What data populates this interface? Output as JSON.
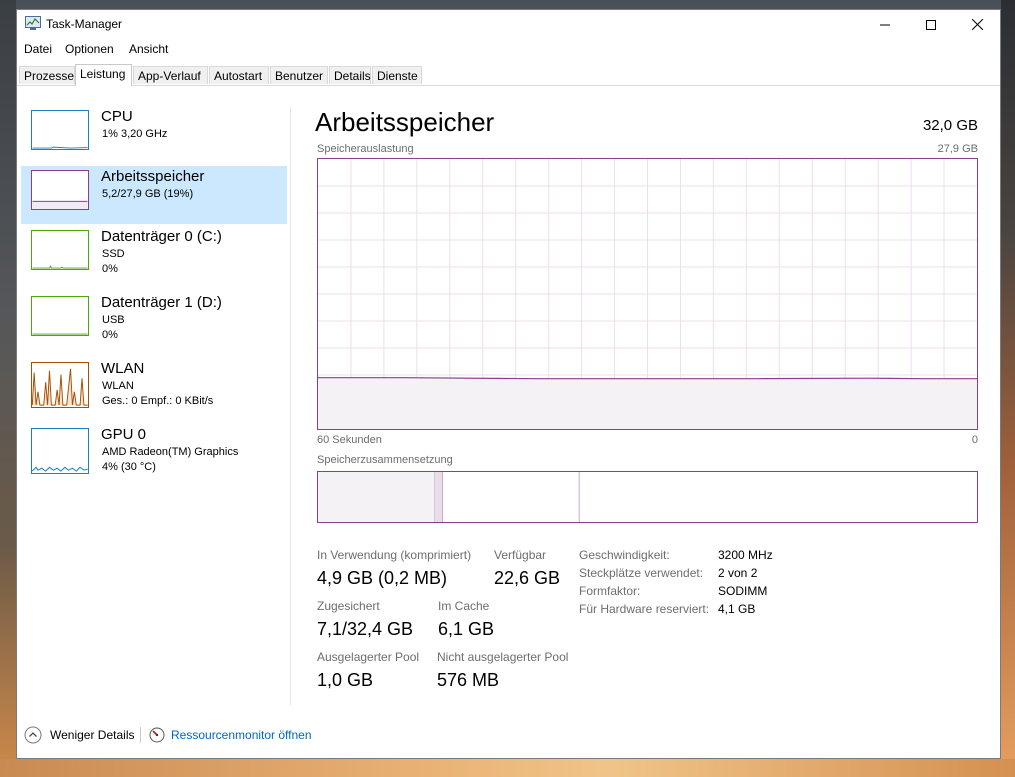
{
  "window": {
    "title": "Task-Manager",
    "controls": {
      "minimize": "minimize-icon",
      "maximize": "maximize-icon",
      "close": "close-icon"
    }
  },
  "menu": [
    "Datei",
    "Optionen",
    "Ansicht"
  ],
  "tabs": [
    "Prozesse",
    "Leistung",
    "App-Verlauf",
    "Autostart",
    "Benutzer",
    "Details",
    "Dienste"
  ],
  "active_tab": "Leistung",
  "sidebar": {
    "cpu": {
      "title": "CPU",
      "line1": "1% 3,20 GHz"
    },
    "memory": {
      "title": "Arbeitsspeicher",
      "line1": "5,2/27,9 GB (19%)"
    },
    "disk0": {
      "title": "Datenträger 0 (C:)",
      "line1": "SSD",
      "line2": "0%"
    },
    "disk1": {
      "title": "Datenträger 1 (D:)",
      "line1": "USB",
      "line2": "0%"
    },
    "wlan": {
      "title": "WLAN",
      "line1": "WLAN",
      "line2": "Ges.: 0 Empf.: 0 KBit/s"
    },
    "gpu": {
      "title": "GPU 0",
      "line1": "AMD Radeon(TM) Graphics",
      "line2": "4% (30 °C)"
    }
  },
  "main": {
    "title": "Arbeitsspeicher",
    "total": "32,0 GB",
    "usage_label": "Speicherauslastung",
    "usage_max": "27,9 GB",
    "time_label": "60 Sekunden",
    "time_end": "0",
    "composition_label": "Speicherzusammensetzung"
  },
  "stats": {
    "in_use_label": "In Verwendung (komprimiert)",
    "in_use_value": "4,9 GB (0,2 MB)",
    "available_label": "Verfügbar",
    "available_value": "22,6 GB",
    "committed_label": "Zugesichert",
    "committed_value": "7,1/32,4 GB",
    "cached_label": "Im Cache",
    "cached_value": "6,1 GB",
    "paged_label": "Ausgelagerter Pool",
    "paged_value": "1,0 GB",
    "nonpaged_label": "Nicht ausgelagerter Pool",
    "nonpaged_value": "576 MB"
  },
  "details": {
    "speed_label": "Geschwindigkeit:",
    "speed_value": "3200 MHz",
    "slots_label": "Steckplätze verwendet:",
    "slots_value": "2 von 2",
    "form_label": "Formfaktor:",
    "form_value": "SODIMM",
    "reserved_label": "Für Hardware reserviert:",
    "reserved_value": "4,1 GB"
  },
  "footer": {
    "fewer_details": "Weniger Details",
    "resource_monitor": "Ressourcenmonitor öffnen"
  },
  "chart_data": {
    "type": "area",
    "ylim": [
      0,
      27.9
    ],
    "xlim": [
      60,
      0
    ],
    "x": [
      60,
      52,
      40,
      30,
      20,
      10,
      5,
      0
    ],
    "values": [
      5.3,
      5.3,
      5.2,
      5.2,
      5.2,
      5.25,
      5.2,
      5.2
    ]
  },
  "colors": {
    "memory": "#8b3f8b",
    "memory_fill": "#f4f2f4",
    "cpu": "#1c7fc4",
    "disk": "#4da60c",
    "wlan": "#a74f01",
    "selected": "#cce8ff",
    "link": "#0066cc"
  }
}
